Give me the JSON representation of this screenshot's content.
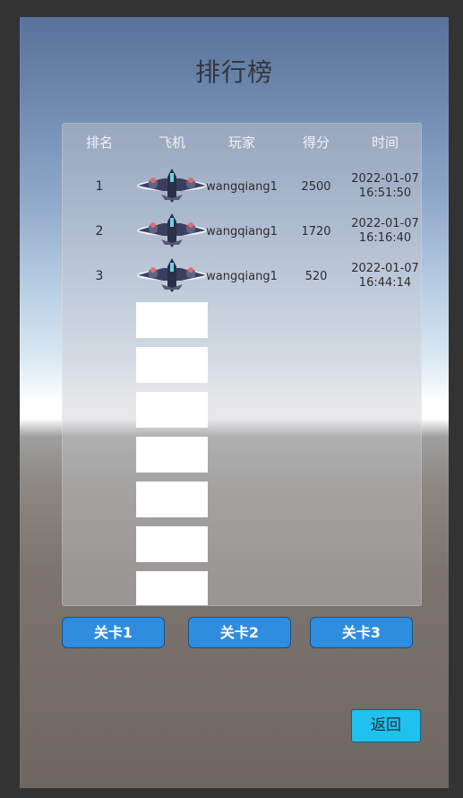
{
  "title": "排行榜",
  "headers": {
    "rank": "排名",
    "plane": "飞机",
    "player": "玩家",
    "score": "得分",
    "time": "时间"
  },
  "rows": [
    {
      "rank": "1",
      "player": "wangqiang1",
      "score": "2500",
      "date": "2022-01-07",
      "clock": "16:51:50"
    },
    {
      "rank": "2",
      "player": "wangqiang1",
      "score": "1720",
      "date": "2022-01-07",
      "clock": "16:16:40"
    },
    {
      "rank": "3",
      "player": "wangqiang1",
      "score": "520",
      "date": "2022-01-07",
      "clock": "16:44:14"
    }
  ],
  "empty_slots": 7,
  "level_buttons": [
    "关卡1",
    "关卡2",
    "关卡3"
  ],
  "back_label": "返回",
  "colors": {
    "level_button": "#2f8de0",
    "back_button": "#1fc1ef",
    "sky_top": "#5a729c",
    "ground": "#6e6762"
  },
  "icons": {
    "plane": "fighter-jet-icon"
  }
}
